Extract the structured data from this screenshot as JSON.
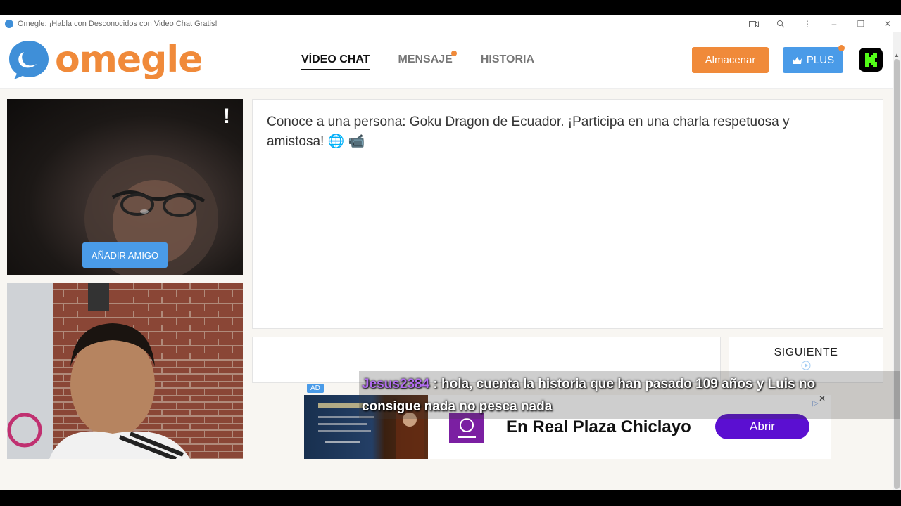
{
  "window": {
    "title": "Omegle: ¡Habla con Desconocidos con Video Chat Gratis!"
  },
  "header": {
    "logo_text": "omegle",
    "nav": [
      {
        "label": "VÍDEO CHAT",
        "active": true
      },
      {
        "label": "MENSAJE",
        "badge": true
      },
      {
        "label": "HISTORIA"
      }
    ],
    "store_label": "Almacenar",
    "plus_label": "PLUS"
  },
  "video": {
    "report_label": "!",
    "add_friend_label": "AÑADIR AMIGO"
  },
  "chat": {
    "intro_text": "Conoce a una persona: Goku Dragon de Ecuador. ¡Participa en una charla respetuosa y amistosa! 🌐 📹",
    "next_label": "SIGUIENTE"
  },
  "ad": {
    "tag": "AD",
    "text": "En Real Plaza Chiclayo",
    "button_label": "Abrir",
    "brand_colors": {
      "button": "#5b0fd1",
      "logo": "#7b1fa2"
    }
  },
  "stream_overlay": {
    "username": "Jesus2384",
    "message_line1": " : hola, cuenta la historia que han pasado 109 años y Luis no",
    "message_line2": "consigue nada no pesca nada"
  },
  "colors": {
    "accent_orange": "#f08a3a",
    "accent_blue": "#4a9be8",
    "background": "#f8f6f2"
  }
}
